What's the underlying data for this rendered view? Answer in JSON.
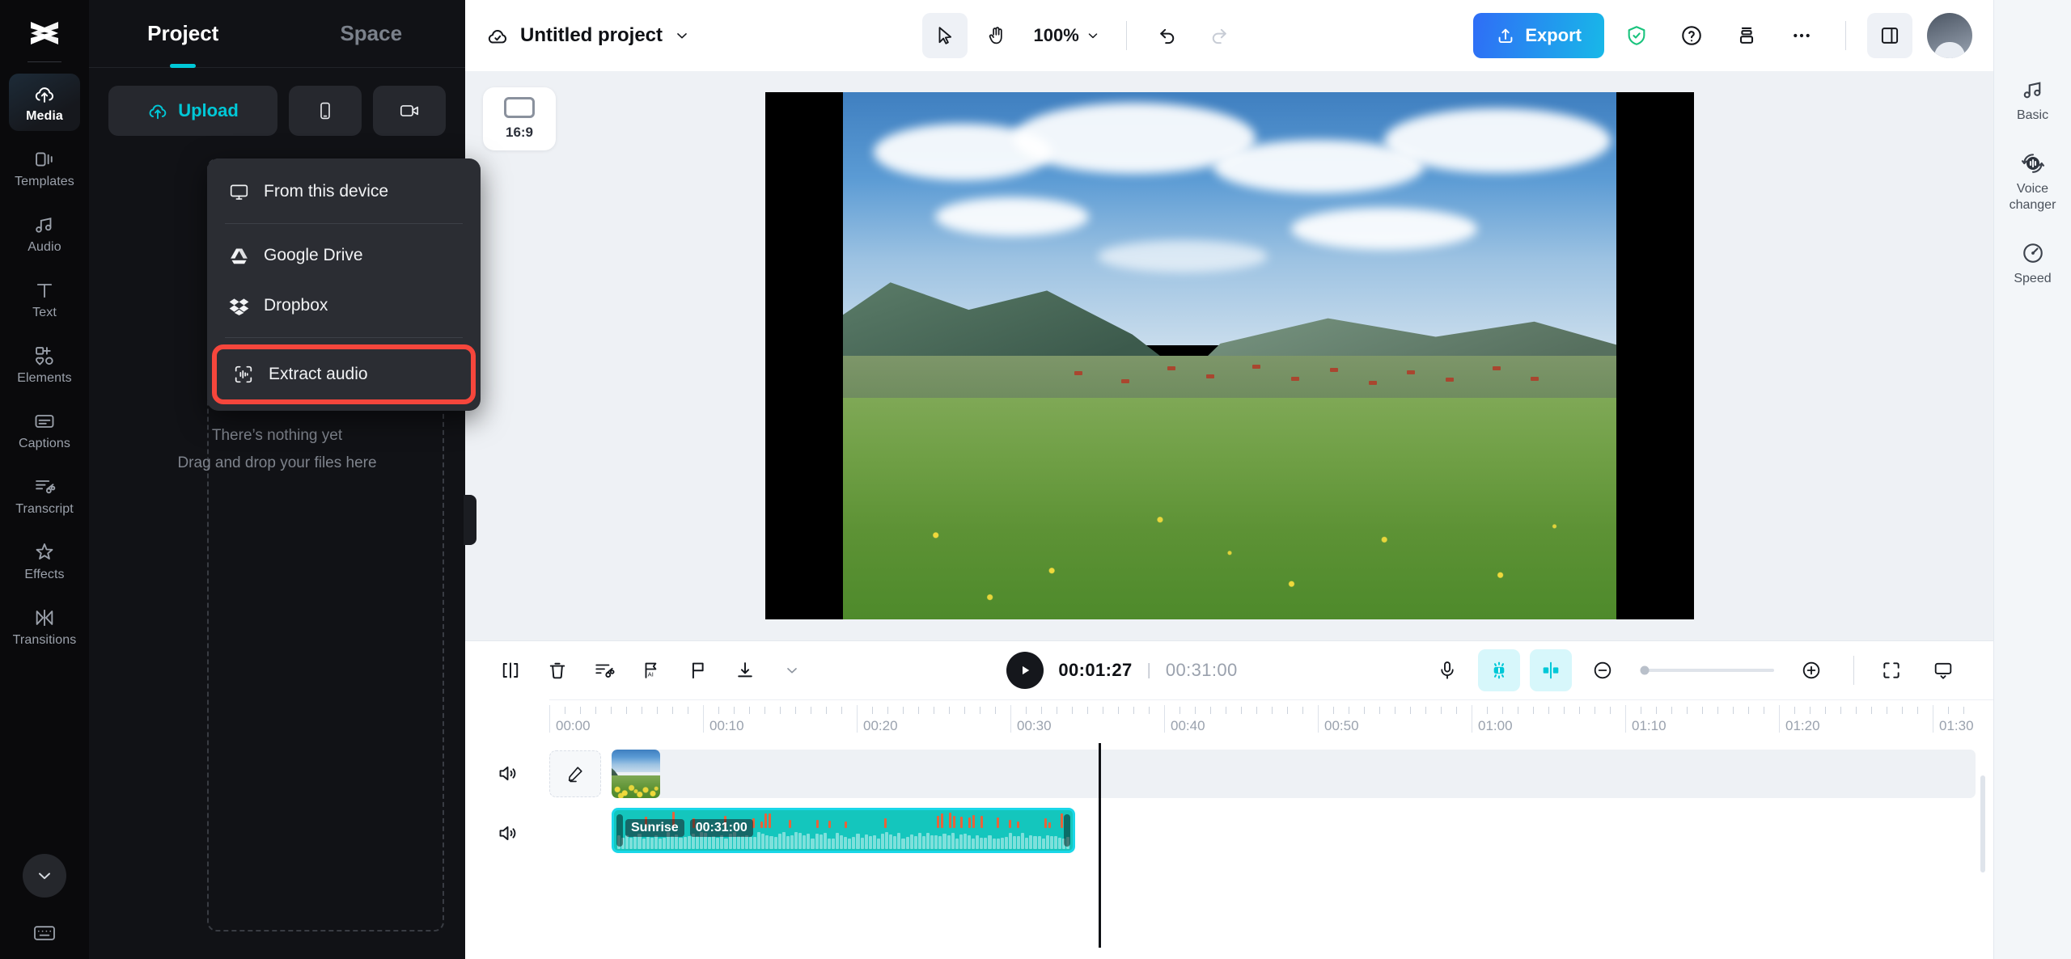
{
  "app": {
    "name": "CapCut Web Editor"
  },
  "rail": {
    "logo_icon": "capcut-logo-icon",
    "items": [
      {
        "label": "Media",
        "icon": "cloud-upload-icon",
        "active": true
      },
      {
        "label": "Templates",
        "icon": "templates-icon",
        "active": false
      },
      {
        "label": "Audio",
        "icon": "music-note-icon",
        "active": false
      },
      {
        "label": "Text",
        "icon": "text-t-icon",
        "active": false
      },
      {
        "label": "Elements",
        "icon": "elements-icon",
        "active": false
      },
      {
        "label": "Captions",
        "icon": "captions-icon",
        "active": false
      },
      {
        "label": "Transcript",
        "icon": "transcript-icon",
        "active": false
      },
      {
        "label": "Effects",
        "icon": "star-sparkle-icon",
        "active": false
      },
      {
        "label": "Transitions",
        "icon": "transitions-icon",
        "active": false
      }
    ],
    "collapse_icon": "chevron-down-icon",
    "bottom_icon": "keyboard-icon"
  },
  "panel": {
    "tabs": [
      {
        "label": "Project",
        "active": true
      },
      {
        "label": "Space",
        "active": false
      }
    ],
    "upload_label": "Upload",
    "upload_icon": "cloud-upload-icon",
    "device_icon": "mobile-phone-icon",
    "record_icon": "camera-record-icon",
    "dropdown": [
      {
        "label": "From this device",
        "icon": "monitor-icon",
        "highlighted": false
      },
      {
        "label": "Google Drive",
        "icon": "google-drive-icon",
        "highlighted": false
      },
      {
        "label": "Dropbox",
        "icon": "dropbox-icon",
        "highlighted": false
      },
      {
        "label": "Extract audio",
        "icon": "extract-audio-icon",
        "highlighted": true
      }
    ],
    "empty_title": "There’s nothing yet",
    "empty_sub": "Drag and drop your files here",
    "empty_icon": "cloud-upload-icon"
  },
  "topbar": {
    "cloud_icon": "cloud-saved-icon",
    "project_name": "Untitled project",
    "project_caret": "chevron-down-icon",
    "tools": [
      {
        "name": "select-arrow-icon",
        "selected": true
      },
      {
        "name": "hand-pan-icon",
        "selected": false
      }
    ],
    "zoom_value": "100%",
    "zoom_caret": "chevron-down-icon",
    "undo_icon": "undo-icon",
    "redo_icon": "redo-icon",
    "export_label": "Export",
    "export_icon": "upload-share-icon",
    "export_color": "#2f6df6",
    "shield_icon": "shield-check-icon",
    "shield_color": "#19c37d",
    "help_icon": "question-circle-icon",
    "apps_icon": "stack-apps-icon",
    "more_icon": "more-horizontal-icon",
    "layout_icon": "panel-layout-icon",
    "avatar_icon": "user-avatar"
  },
  "stage": {
    "ratio_label": "16:9",
    "ratio_icon": "aspect-ratio-icon"
  },
  "timeline": {
    "tools": [
      {
        "name": "split-icon",
        "aqua": false
      },
      {
        "name": "delete-trash-icon",
        "aqua": false
      },
      {
        "name": "auto-cut-icon",
        "aqua": false
      },
      {
        "name": "ai-flag-icon",
        "aqua": false
      },
      {
        "name": "marker-flag-icon",
        "aqua": false
      },
      {
        "name": "download-icon",
        "aqua": false
      },
      {
        "name": "chevron-down-icon",
        "aqua": false
      }
    ],
    "play_icon": "play-icon",
    "current_time": "00:01:27",
    "time_separator": "|",
    "total_time": "00:31:00",
    "right_tools": [
      {
        "name": "microphone-icon",
        "aqua": false
      },
      {
        "name": "auto-enhance-icon",
        "aqua": true
      },
      {
        "name": "audio-split-icon",
        "aqua": true
      }
    ],
    "zoom_out_icon": "minus-circle-icon",
    "zoom_in_icon": "plus-circle-icon",
    "fullscreen_icon": "fullscreen-icon",
    "fit-screen_icon": "fit-screen-icon",
    "ruler_labels": [
      "00:00",
      "00:10",
      "00:20",
      "00:30",
      "00:40",
      "00:50",
      "01:00",
      "01:10",
      "01:20",
      "01:30"
    ],
    "playhead_time": "00:01:27",
    "tracks": [
      {
        "type": "video",
        "mute_icon": "speaker-on-icon",
        "edit_icon": "pencil-edit-icon"
      },
      {
        "type": "audio",
        "mute_icon": "speaker-on-icon",
        "clip_name": "Sunrise",
        "clip_duration": "00:31:00",
        "clip_color": "#14c6bd"
      }
    ]
  },
  "right_rail": {
    "items": [
      {
        "label": "Basic",
        "icon": "music-note-icon"
      },
      {
        "label": "Voice\nchanger",
        "icon": "voice-changer-icon"
      },
      {
        "label": "Speed",
        "icon": "speed-gauge-icon"
      }
    ]
  }
}
